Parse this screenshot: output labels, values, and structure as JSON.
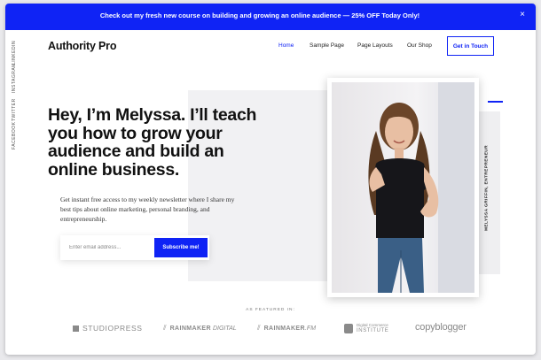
{
  "promo": {
    "text": "Check out my fresh new course on building and growing an online audience — 25% OFF Today Only!",
    "close": "×"
  },
  "social": [
    "FACEBOOK",
    "TWITTER",
    "INSTAGRAM",
    "LINKEDIN"
  ],
  "header": {
    "brand": "Authority Pro",
    "nav": [
      "Home",
      "Sample Page",
      "Page Layouts",
      "Our Shop"
    ],
    "active_nav": "Home",
    "cta": "Get in Touch"
  },
  "hero": {
    "title": "Hey, I’m Melyssa. I’ll teach you how to grow your audience and build an online business.",
    "text": "Get instant free access to my weekly newsletter where I share my best tips about online marketing, personal branding, and entrepreneurship.",
    "email_placeholder": "Enter email address...",
    "subscribe": "Subscribe me!",
    "photo_caption": "MELYSSA GRIFFIN, ENTREPRENEUR"
  },
  "featured": {
    "label": "AS FEATURED IN:",
    "logos": {
      "studiopress": "STUDIOPRESS",
      "rainmaker_digital_a": "RAINMAKER",
      "rainmaker_digital_b": "DIGITAL",
      "rainmaker_fm_a": "RAINMAKER",
      "rainmaker_fm_b": ".FM",
      "dci_a": "Digital Commerce",
      "dci_b": "INSTITUTE",
      "copyblogger": "copyblogger"
    }
  },
  "colors": {
    "accent": "#0f23f5",
    "text": "#111111",
    "muted": "#8a8a8a"
  }
}
